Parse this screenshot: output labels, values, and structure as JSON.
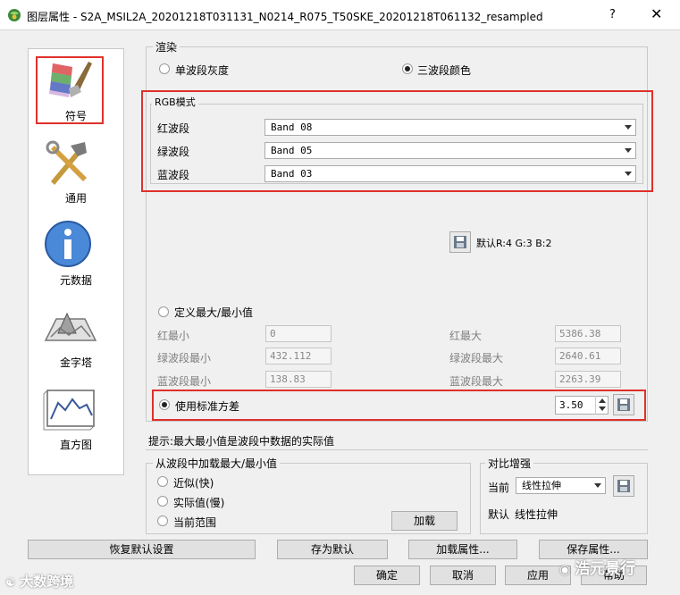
{
  "window": {
    "title": "图层属性 - S2A_MSIL2A_20201218T031131_N0214_R075_T50SKE_20201218T061132_resampled",
    "help": "?",
    "close": "✕"
  },
  "nav": {
    "items": [
      {
        "label": "符号",
        "icon": "brush-icon"
      },
      {
        "label": "通用",
        "icon": "tools-icon"
      },
      {
        "label": "元数据",
        "icon": "info-icon"
      },
      {
        "label": "金字塔",
        "icon": "pyramid-map-icon"
      },
      {
        "label": "直方图",
        "icon": "histogram-icon"
      }
    ]
  },
  "render": {
    "group_title": "渲染",
    "single_band": "单波段灰度",
    "three_band": "三波段颜色",
    "rgb_title": "RGB模式",
    "red_label": "红波段",
    "green_label": "绿波段",
    "blue_label": "蓝波段",
    "red_band": "Band 08",
    "green_band": "Band 05",
    "blue_band": "Band 03",
    "default_rgb": "默认R:4 G:3 B:2",
    "custom_minmax": "定义最大/最小值",
    "red_min_label": "红最小",
    "red_min": "0",
    "red_max_label": "红最大",
    "red_max": "5386.38",
    "green_min_label": "绿波段最小",
    "green_min": "432.112",
    "green_max_label": "绿波段最大",
    "green_max": "2640.61",
    "blue_min_label": "蓝波段最小",
    "blue_min": "138.83",
    "blue_max_label": "蓝波段最大",
    "blue_max": "2263.39",
    "std_dev": "使用标准方差",
    "std_dev_value": "3.50"
  },
  "hint": "提示:最大最小值是波段中数据的实际值",
  "load": {
    "group_title": "从波段中加载最大/最小值",
    "approx": "近似(快)",
    "actual": "实际值(慢)",
    "current": "当前范围",
    "load_button": "加载"
  },
  "contrast": {
    "group_title": "对比增强",
    "current_label": "当前",
    "current_value": "线性拉伸",
    "default_label": "默认",
    "default_value": "线性拉伸"
  },
  "buttons": {
    "restore_default": "恢复默认设置",
    "save_default": "存为默认",
    "load_style": "加载属性...",
    "save_style": "保存属性...",
    "ok": "确定",
    "cancel": "取消",
    "apply": "应用",
    "help": "帮助"
  },
  "watermark": {
    "left": "大数跨境",
    "right": "浩元景行"
  },
  "colors": {
    "highlight": "#e0302a"
  }
}
